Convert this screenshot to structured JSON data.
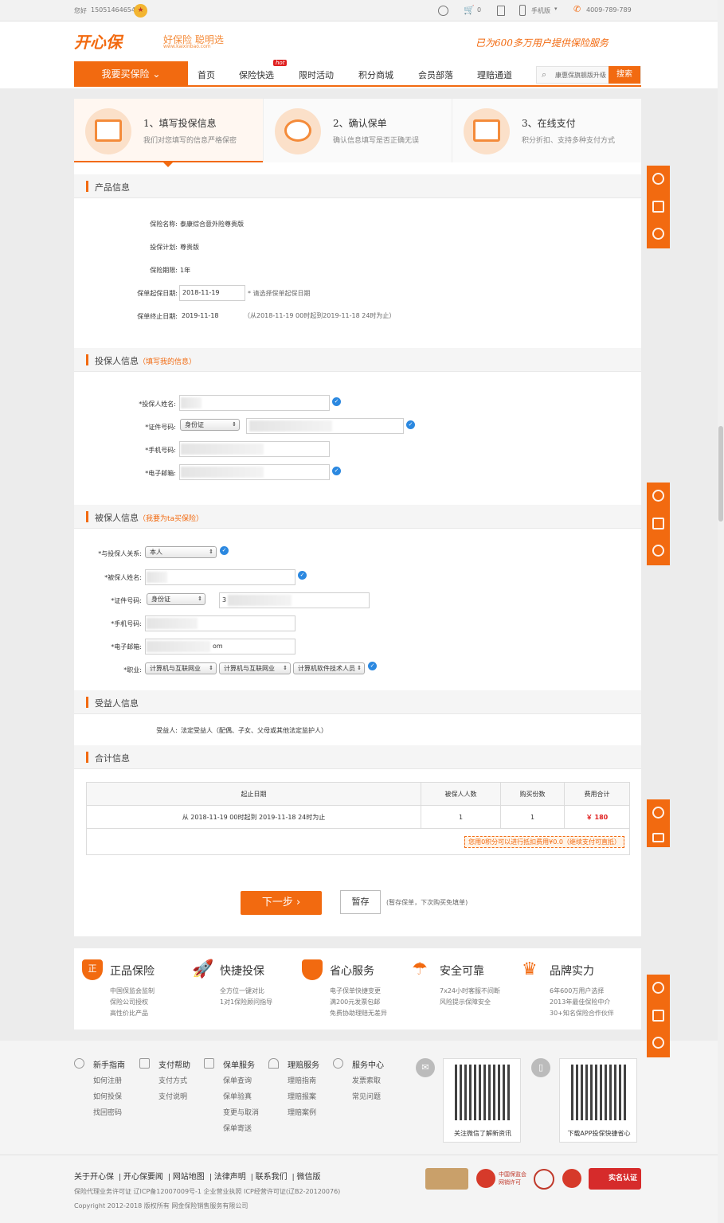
{
  "topbar": {
    "greeting": "您好",
    "phone_user": "15051464654",
    "cart_count": "0",
    "mobile": "手机版",
    "hotline": "4009-789-789"
  },
  "header": {
    "logo": "开心保",
    "slogan": "好保险 聪明选",
    "site": "www.kaixinbao.com",
    "tagline": "已为600多万用户提供保险服务",
    "buy_button": "我要买保险",
    "nav": [
      "首页",
      "保险快选",
      "限时活动",
      "积分商城",
      "会员部落",
      "理赔通道"
    ],
    "hot_badge": "hot",
    "search_placeholder": "康惠保旗舰版升级",
    "search_button": "搜索"
  },
  "steps": [
    {
      "title": "1、填写投保信息",
      "sub": "我们对您填写的信息严格保密"
    },
    {
      "title": "2、确认保单",
      "sub": "确认信息填写是否正确无误"
    },
    {
      "title": "3、在线支付",
      "sub": "积分折扣、支持多种支付方式"
    }
  ],
  "product": {
    "heading": "产品信息",
    "name_label": "保险名称:",
    "name_value": "泰康综合意外险尊贵版",
    "plan_label": "投保计划:",
    "plan_value": "尊贵版",
    "term_label": "保险期限:",
    "term_value": "1年",
    "start_label": "保单起保日期:",
    "start_value": "2018-11-19",
    "start_hint": "* 请选择保单起保日期",
    "end_label": "保单终止日期:",
    "end_value": "2019-11-18",
    "end_note": "（从2018-11-19 00时起到2019-11-18 24时为止）"
  },
  "applicant": {
    "heading": "投保人信息",
    "sub": "（填写我的信息）",
    "name_label": "*投保人姓名:",
    "id_label": "*证件号码:",
    "id_type": "身份证",
    "phone_label": "*手机号码:",
    "email_label": "*电子邮箱:"
  },
  "insured": {
    "heading": "被保人信息",
    "sub": "（我要为ta买保险）",
    "relation_label": "*与投保人关系:",
    "relation_value": "本人",
    "name_label": "*被保人姓名:",
    "id_label": "*证件号码:",
    "id_type": "身份证",
    "id_partial": "3",
    "phone_label": "*手机号码:",
    "email_label": "*电子邮箱:",
    "email_partial": "om",
    "job_label": "*职业:",
    "job1": "计算机与互联网业",
    "job2": "计算机与互联网业",
    "job3": "计算机软件技术人员"
  },
  "beneficiary": {
    "heading": "受益人信息",
    "label": "受益人:",
    "value": "法定受益人（配偶、子女、父母或其他法定监护人）"
  },
  "total": {
    "heading": "合计信息",
    "headers": [
      "起止日期",
      "被保人人数",
      "购买份数",
      "费用合计"
    ],
    "period": "从   2018-11-19   00时起到   2019-11-18   24时为止",
    "insured_count": "1",
    "copies": "1",
    "price": "￥ 180",
    "points_note": "您用0积分可以进行抵扣费用¥0.0（继续支付可直抵）"
  },
  "actions": {
    "next": "下一步 ›",
    "save": "暂存",
    "save_note": "(暂存保单，下次购买免填单)"
  },
  "features": [
    {
      "title": "正品保险",
      "icon_text": "正",
      "lines": [
        "中国保监会监制",
        "保险公司授权",
        "高性价比产品"
      ]
    },
    {
      "title": "快捷投保",
      "icon_text": "",
      "lines": [
        "全方位一键对比",
        "1对1保险顾问指导"
      ]
    },
    {
      "title": "省心服务",
      "icon_text": "",
      "lines": [
        "电子保单快捷变更",
        "满200元发票包邮",
        "免费协助理赔无差异"
      ]
    },
    {
      "title": "安全可靠",
      "icon_text": "",
      "lines": [
        "7x24小时客服不间断",
        "风险提示保障安全"
      ]
    },
    {
      "title": "品牌实力",
      "icon_text": "",
      "lines": [
        "6年600万用户选择",
        "2013年最佳保险中介",
        "30+知名保险合作伙伴"
      ]
    }
  ],
  "footer": {
    "cols": [
      {
        "title": "新手指南",
        "items": [
          "如何注册",
          "如何投保",
          "找回密码"
        ]
      },
      {
        "title": "支付帮助",
        "items": [
          "支付方式",
          "支付说明"
        ]
      },
      {
        "title": "保单服务",
        "items": [
          "保单查询",
          "保单验真",
          "变更与取消",
          "保单寄送"
        ]
      },
      {
        "title": "理赔服务",
        "items": [
          "理赔指南",
          "理赔报案",
          "理赔案例"
        ]
      },
      {
        "title": "服务中心",
        "items": [
          "发票索取",
          "常见问题"
        ]
      }
    ],
    "qr1_caption": "关注微信了解新资讯",
    "qr2_caption": "下载APP投保快捷省心",
    "links": [
      "关于开心保",
      "开心保要闻",
      "网站地图",
      "法律声明",
      "联系我们",
      "微信版"
    ],
    "license": "保险代理业务许可证  辽ICP备12007009号-1  企业营业执照  ICP经营许可证(辽B2-20120076)",
    "copyright": "Copyright 2012-2018 版权所有 网金保险销售服务有限公司",
    "badge_realname": "实名认证",
    "badge_circ": "中国保监会 网销许可"
  },
  "colors": {
    "accent": "#f26a10",
    "check": "#2b88e0",
    "price": "#e02020"
  }
}
